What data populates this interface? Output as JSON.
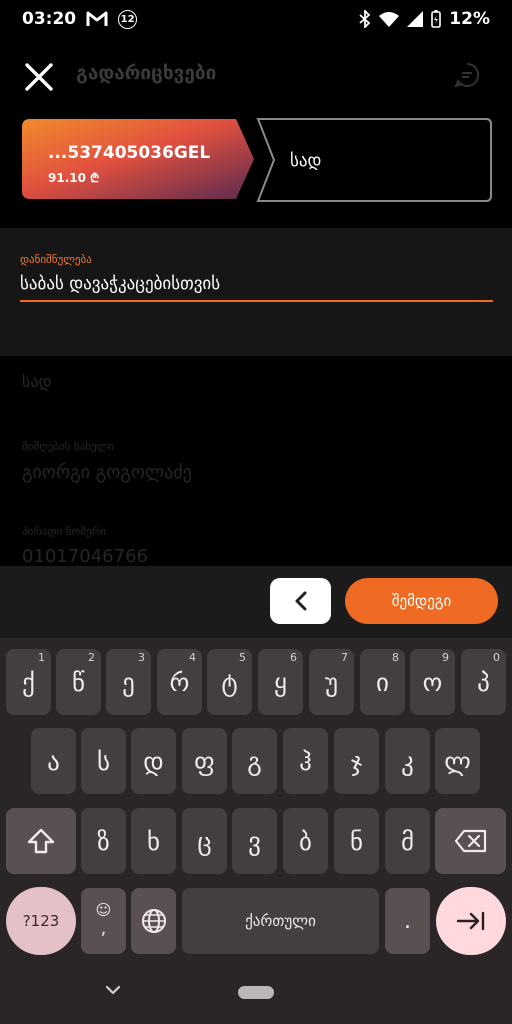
{
  "status_bar": {
    "time": "03:20",
    "gmail_icon": "gmail-icon",
    "notification_count": "12",
    "battery_percent": "12%"
  },
  "header": {
    "title": "გადარიცხვები",
    "close_icon": "close-icon",
    "chat_icon": "chat-icon"
  },
  "transfer": {
    "from_account": "...537405036GEL",
    "from_balance": "91.10 ₾",
    "to_label": "სად"
  },
  "purpose": {
    "label": "დანიშნულება",
    "value": "საბას დავაჭკაცებისთვის"
  },
  "background": {
    "to_label": "სად",
    "recipient_label": "მიმღების სახელი",
    "recipient_name": "გიორგი გოგოლაძე",
    "id_label": "პირადი ნომერი",
    "id_value": "01017046766"
  },
  "actions": {
    "next_label": "შემდეგი"
  },
  "keyboard": {
    "row1": [
      {
        "key": "ქ",
        "hint": "1"
      },
      {
        "key": "წ",
        "hint": "2"
      },
      {
        "key": "ე",
        "hint": "3"
      },
      {
        "key": "რ",
        "hint": "4"
      },
      {
        "key": "ტ",
        "hint": "5"
      },
      {
        "key": "ყ",
        "hint": "6"
      },
      {
        "key": "უ",
        "hint": "7"
      },
      {
        "key": "ი",
        "hint": "8"
      },
      {
        "key": "ო",
        "hint": "9"
      },
      {
        "key": "პ",
        "hint": "0"
      }
    ],
    "row2": [
      "ა",
      "ს",
      "დ",
      "ფ",
      "გ",
      "ჰ",
      "ჯ",
      "კ",
      "ლ"
    ],
    "row3": [
      "ზ",
      "ხ",
      "ც",
      "ვ",
      "ბ",
      "ნ",
      "მ"
    ],
    "symbols_label": "?123",
    "comma_label": ",",
    "emoji_label": "☺",
    "space_label": "ქართული",
    "period_label": "."
  }
}
